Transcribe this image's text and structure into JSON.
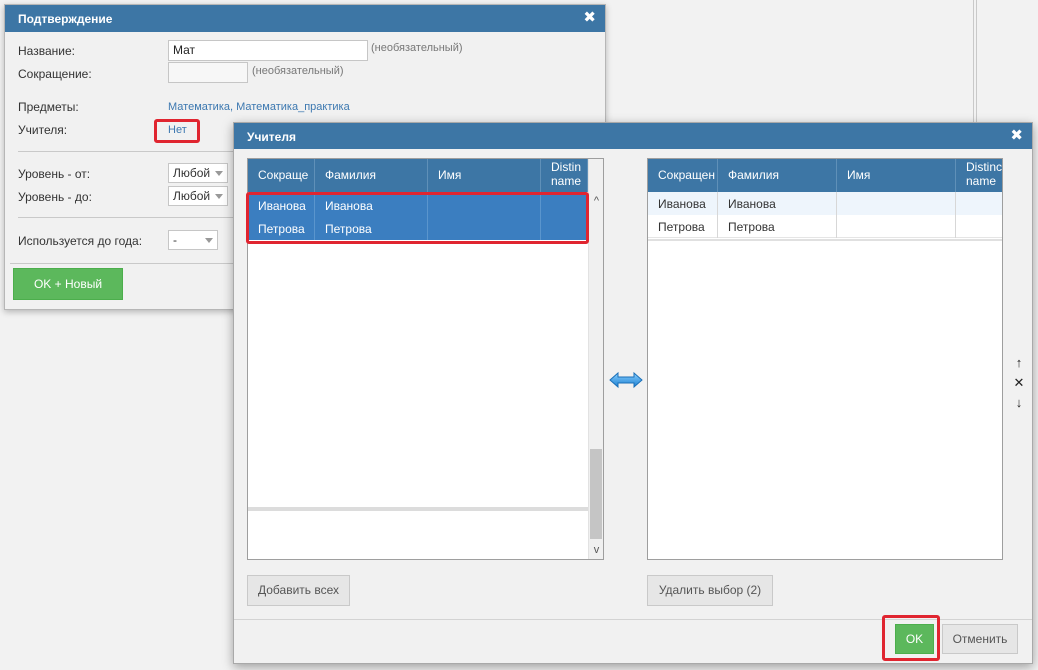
{
  "dialog_confirm": {
    "title": "Подтверждение",
    "close_icon": "close-icon",
    "name_label": "Название:",
    "name_value": "Мат",
    "optional_hint": "(необязательный)",
    "abbr_label": "Сокращение:",
    "abbr_value": "",
    "subjects_label": "Предметы:",
    "subjects_value": "Математика, Математика_практика",
    "teachers_label": "Учителя:",
    "teachers_value": "Нет",
    "level_from_label": "Уровень - от:",
    "level_from_value": "Любой",
    "level_to_label": "Уровень - до:",
    "level_to_value": "Любой",
    "used_until_label": "Используется до года:",
    "used_until_value": "-",
    "ok_new_button": "OK + Новый"
  },
  "dialog_teachers": {
    "title": "Учителя",
    "close_icon": "close-icon",
    "left_grid": {
      "columns": [
        "Сокраще",
        "Фамилия",
        "Имя",
        "Distinguished name"
      ],
      "column_lines": [
        "Distin",
        "name"
      ],
      "rows": [
        {
          "abbr": "Иванова",
          "surname": "Иванова",
          "name": "",
          "dn": ""
        },
        {
          "abbr": "Петрова",
          "surname": "Петрова",
          "name": "",
          "dn": ""
        }
      ],
      "scroll_up": "^",
      "scroll_down": "v"
    },
    "transfer_icon": "double-arrow-icon",
    "right_grid": {
      "columns": [
        "Сокращен",
        "Фамилия",
        "Имя",
        "Distinguished name"
      ],
      "column_lines": [
        "Distinc",
        "name"
      ],
      "rows": [
        {
          "abbr": "Иванова",
          "surname": "Иванова",
          "name": "",
          "dn": ""
        },
        {
          "abbr": "Петрова",
          "surname": "Петрова",
          "name": "",
          "dn": ""
        }
      ]
    },
    "order_controls": {
      "up": "↑",
      "remove": "✕",
      "down": "↓"
    },
    "add_all_button": "Добавить всех",
    "remove_selected_button": "Удалить выбор (2)",
    "ok_button": "OK",
    "cancel_button": "Отменить"
  },
  "colors": {
    "header_blue": "#3d76a5",
    "selection_blue": "#3b7ec0",
    "ok_green": "#5cb85c",
    "highlight_red": "#e02530"
  }
}
